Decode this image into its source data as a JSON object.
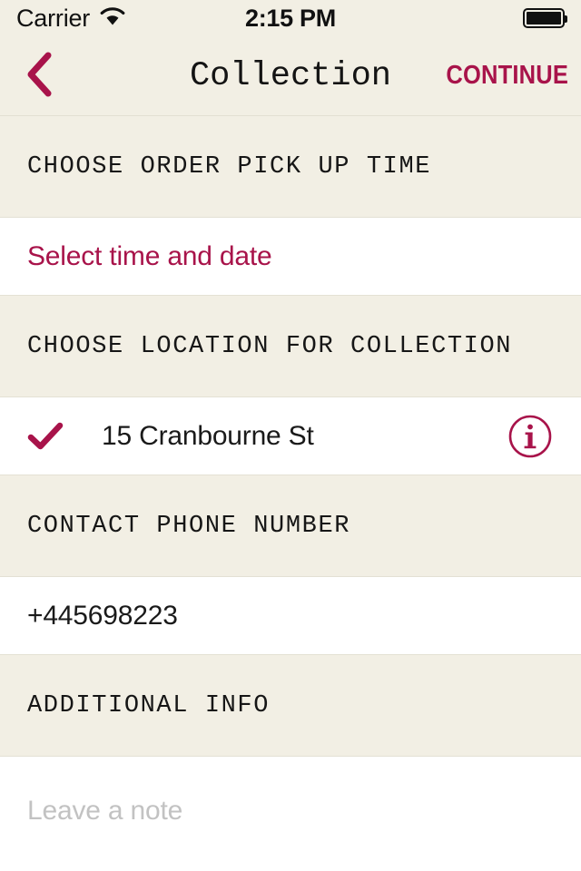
{
  "statusbar": {
    "carrier": "Carrier",
    "time": "2:15 PM",
    "wifi_icon": "wifi-icon",
    "battery_icon": "battery-full-icon"
  },
  "navbar": {
    "back_icon": "chevron-left-icon",
    "title": "Collection",
    "continue_label": "CONTINUE"
  },
  "sections": [
    {
      "header": "CHOOSE ORDER PICK UP TIME",
      "value": "Select time and date"
    },
    {
      "header": "CHOOSE LOCATION FOR COLLECTION",
      "value": "15 Cranbourne St",
      "check_icon": "check-icon",
      "info_icon": "info-circle-icon"
    },
    {
      "header": "CONTACT PHONE NUMBER",
      "value": "+445698223"
    },
    {
      "header": "ADDITIONAL INFO",
      "placeholder": "Leave a note"
    }
  ],
  "colors": {
    "accent": "#A8134A",
    "beige": "#F2EFE4",
    "white": "#FFFFFF",
    "text_dark": "#1A1A1A",
    "placeholder": "#C2C2C2",
    "divider": "#E4E1D4"
  }
}
